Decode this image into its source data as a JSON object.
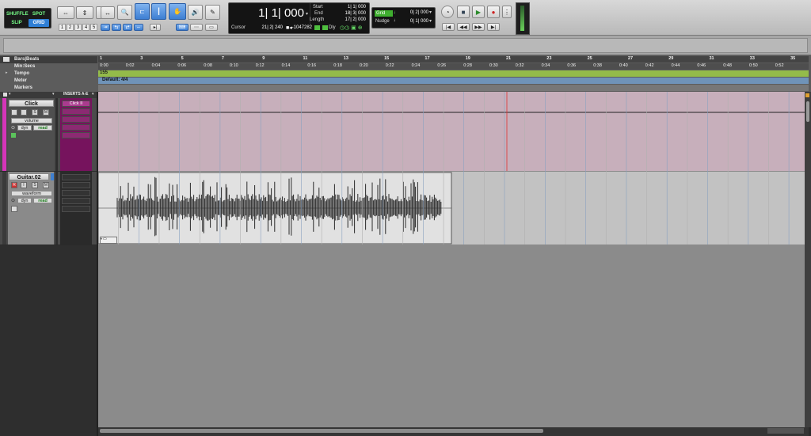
{
  "modes": {
    "shuffle": "SHUFFLE",
    "spot": "SPOT",
    "slip": "SLIP",
    "grid": "GRID"
  },
  "zoom_presets": [
    "1",
    "2",
    "3",
    "4",
    "5"
  ],
  "counter": {
    "main": "1| 1| 000",
    "start_label": "Start",
    "start": "1| 1| 000",
    "end_label": "End",
    "end": "18| 3| 000",
    "length_label": "Length",
    "length": "17| 2| 000",
    "cursor_label": "Cursor",
    "cursor": "21| 2| 240",
    "sample": "-1047282",
    "dly": "Dly"
  },
  "grid": {
    "grid_label": "Grid",
    "grid_value": "0| 2| 000",
    "nudge_label": "Nudge",
    "nudge_value": "0| 1| 000"
  },
  "rulers": {
    "bars_label": "Bars|Beats",
    "minsecs_label": "Min:Secs",
    "tempo_label": "Tempo",
    "meter_label": "Meter",
    "markers_label": "Markers",
    "bars": [
      "1",
      "3",
      "5",
      "7",
      "9",
      "11",
      "13",
      "15",
      "17",
      "19",
      "21",
      "23",
      "25",
      "27",
      "29",
      "31",
      "33",
      "35"
    ],
    "times": [
      "0:00",
      "0:02",
      "0:04",
      "0:06",
      "0:08",
      "0:10",
      "0:12",
      "0:14",
      "0:16",
      "0:18",
      "0:20",
      "0:22",
      "0:24",
      "0:26",
      "0:28",
      "0:30",
      "0:32",
      "0:34",
      "0:36",
      "0:38",
      "0:40",
      "0:42",
      "0:44",
      "0:46",
      "0:48",
      "0:50",
      "0:52"
    ],
    "tempo_value": "155",
    "meter_value": "Default: 4/4"
  },
  "tracks": [
    {
      "name": "Click",
      "view": "volume",
      "dyn": "dyn",
      "auto": "read",
      "insert_header": "INSERTS A-E",
      "insert1": "Click II",
      "color": "#d535b8"
    },
    {
      "name": "Guitar.02",
      "view": "waveform",
      "dyn": "dyn",
      "auto": "read"
    }
  ],
  "button_glyphs": {
    "rec": "R",
    "solo": "S",
    "mute": "M",
    "input": "I"
  }
}
